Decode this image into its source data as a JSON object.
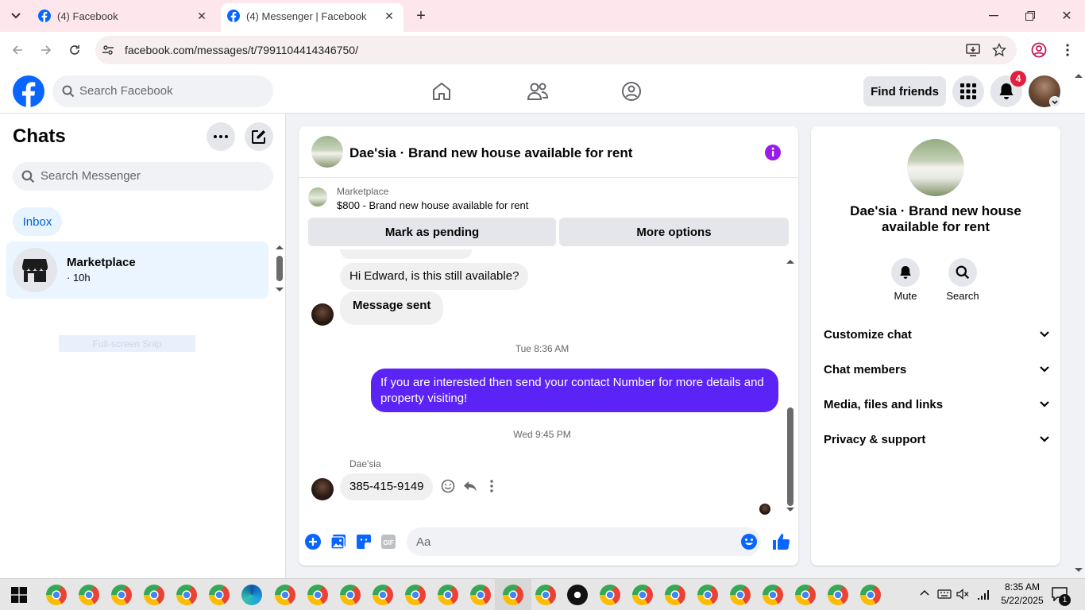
{
  "browser": {
    "tabs": [
      {
        "title": "(4) Facebook",
        "active": false
      },
      {
        "title": "(4) Messenger | Facebook",
        "active": true
      }
    ],
    "url": "facebook.com/messages/t/7991104414346750/"
  },
  "header": {
    "search_placeholder": "Search Facebook",
    "find_friends": "Find friends",
    "notification_count": "4",
    "brand_color": "#0866ff"
  },
  "sidebar": {
    "title": "Chats",
    "search_placeholder": "Search Messenger",
    "filter": "Inbox",
    "conversations": [
      {
        "name": "Marketplace",
        "time": "· 10h"
      }
    ],
    "snip_overlay": "Full-screen Snip"
  },
  "chat": {
    "title": "Dae'sia · Brand new house available for rent",
    "marketplace_label": "Marketplace",
    "listing": "$800 - Brand new house available for rent",
    "actions": [
      "Mark as pending",
      "More options"
    ],
    "messages": [
      {
        "type": "incoming",
        "text": "Hi Edward, is this still available?"
      },
      {
        "type": "incoming",
        "text": "Message sent"
      },
      {
        "type": "timestamp",
        "text": "Tue 8:36 AM"
      },
      {
        "type": "outgoing",
        "text": "If you are interested then send your contact Number  for more details and property visiting!"
      },
      {
        "type": "timestamp",
        "text": "Wed 9:45 PM"
      },
      {
        "type": "sender",
        "text": "Dae'sia"
      },
      {
        "type": "incoming",
        "text": "385-415-9149"
      }
    ],
    "composer_placeholder": "Aa",
    "outgoing_color": "#5b23f5",
    "accent_color": "#0866ff"
  },
  "details": {
    "name": "Dae'sia · Brand new house available for rent",
    "actions": [
      "Mute",
      "Search"
    ],
    "sections": [
      "Customize chat",
      "Chat members",
      "Media, files and links",
      "Privacy & support"
    ]
  },
  "taskbar": {
    "time": "8:35 AM",
    "date": "5/22/2025",
    "notification_count": "1"
  }
}
